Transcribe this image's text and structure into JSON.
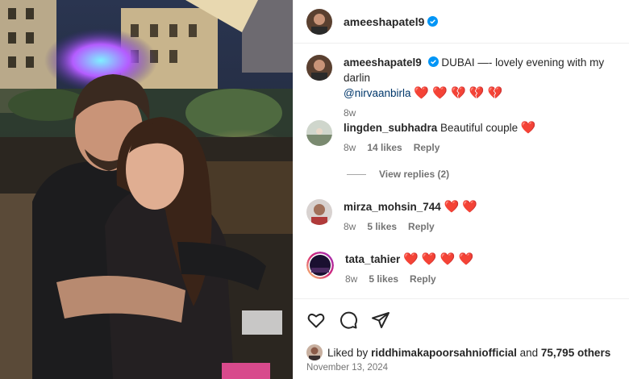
{
  "header": {
    "username": "ameeshapatel9"
  },
  "caption": {
    "username": "ameeshapatel9",
    "text": "DUBAI —- lovely evening with my darlin",
    "mention": "@nirvaanbirla",
    "hearts": "❤️ ❤️ 💔 💔 💔",
    "time": "8w"
  },
  "comments": [
    {
      "username": "lingden_subhadra",
      "text": "Beautiful couple",
      "hearts": "❤️",
      "time": "8w",
      "likes": "14 likes",
      "reply": "Reply"
    },
    {
      "username": "mirza_mohsin_744",
      "text": "",
      "hearts": "❤️ ❤️",
      "time": "8w",
      "likes": "5 likes",
      "reply": "Reply"
    },
    {
      "username": "tata_tahier",
      "text": "",
      "hearts": "❤️ ❤️ ❤️ ❤️",
      "time": "8w",
      "likes": "5 likes",
      "reply": "Reply"
    }
  ],
  "view_replies": "View replies (2)",
  "likes": {
    "prefix": "Liked by",
    "user": "riddhimakapoorsahniofficial",
    "and": "and",
    "count": "75,795 others"
  },
  "date": "November 13, 2024",
  "colors": {
    "verified": "#0095f6",
    "heart": "#ed1c24",
    "link": "#00376b"
  }
}
